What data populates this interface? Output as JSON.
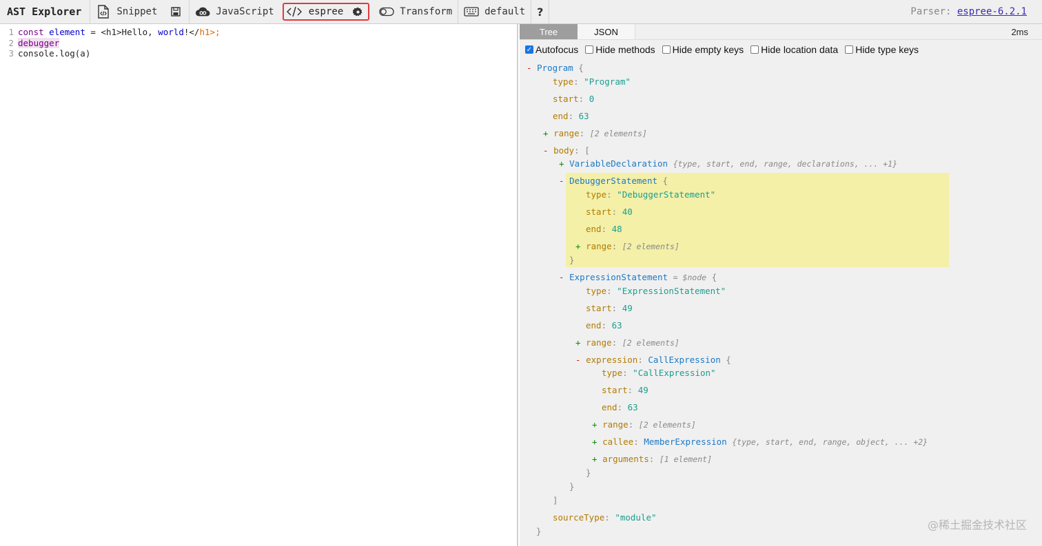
{
  "toolbar": {
    "brand": "AST Explorer",
    "snippet": "Snippet",
    "language": "JavaScript",
    "parser": "espree",
    "transform": "Transform",
    "keymap": "default",
    "help": "?",
    "parser_label": "Parser:",
    "parser_version": "espree-6.2.1"
  },
  "editor": {
    "lines": [
      {
        "num": "1",
        "const": "const",
        "var": "element",
        "eq": " = ",
        "open": "<h1>Hello, ",
        "world": "world",
        "close": "!</",
        "h1": "h1>;"
      },
      {
        "num": "2",
        "text": "debugger"
      },
      {
        "num": "3",
        "text": "console.log(a)"
      }
    ]
  },
  "pane": {
    "tabs": [
      "Tree",
      "JSON"
    ],
    "timing": "2ms",
    "options": [
      "Autofocus",
      "Hide methods",
      "Hide empty keys",
      "Hide location data",
      "Hide type keys"
    ]
  },
  "tree": {
    "program": "Program",
    "type_key": "type",
    "start_key": "start",
    "end_key": "end",
    "range_key": "range",
    "body_key": "body",
    "program_type": "\"Program\"",
    "program_start": "0",
    "program_end": "63",
    "two_elements": "[2 elements]",
    "var_decl": "VariableDeclaration",
    "var_decl_summary": "{type, start, end, range, declarations, ... +1}",
    "debugger": "DebuggerStatement",
    "debugger_type": "\"DebuggerStatement\"",
    "debugger_start": "40",
    "debugger_end": "48",
    "expr": "ExpressionStatement",
    "expr_node": "= $node",
    "expr_type": "\"ExpressionStatement\"",
    "expr_start": "49",
    "expr_end": "63",
    "expression_key": "expression",
    "call": "CallExpression",
    "call_type": "\"CallExpression\"",
    "call_start": "49",
    "call_end": "63",
    "callee_key": "callee",
    "member": "MemberExpression",
    "member_summary": "{type, start, end, range, object, ... +2}",
    "arguments_key": "arguments",
    "one_element": "[1 element]",
    "source_type_key": "sourceType",
    "source_type": "\"module\""
  },
  "watermark": "@稀土掘金技术社区"
}
